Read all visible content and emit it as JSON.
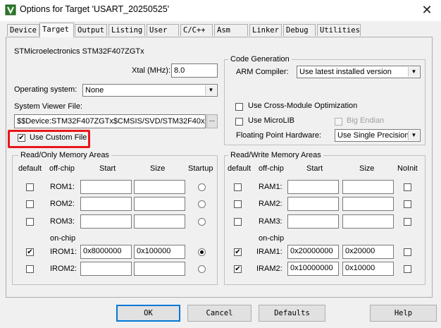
{
  "window": {
    "title": "Options for Target 'USART_20250525'",
    "close_glyph": "✕"
  },
  "tabs": [
    {
      "label": "Device"
    },
    {
      "label": "Target",
      "active": true
    },
    {
      "label": "Output"
    },
    {
      "label": "Listing"
    },
    {
      "label": "User"
    },
    {
      "label": "C/C++"
    },
    {
      "label": "Asm"
    },
    {
      "label": "Linker"
    },
    {
      "label": "Debug"
    },
    {
      "label": "Utilities"
    }
  ],
  "device_name": "STMicroelectronics STM32F407ZGTx",
  "xtal": {
    "label": "Xtal (MHz):",
    "value": "8.0"
  },
  "os": {
    "label": "Operating system:",
    "value": "None"
  },
  "svd": {
    "label": "System Viewer File:",
    "value": "$$Device:STM32F407ZGTx$CMSIS/SVD/STM32F40x",
    "browse": "..."
  },
  "custom_file": {
    "label": "Use Custom File",
    "checked": true
  },
  "code_gen": {
    "title": "Code Generation",
    "compiler_label": "ARM Compiler:",
    "compiler_value": "Use latest installed version",
    "cross_module": "Use Cross-Module Optimization",
    "microlib": "Use MicroLIB",
    "big_endian": "Big Endian",
    "fp_label": "Floating Point Hardware:",
    "fp_value": "Use Single Precision"
  },
  "rom": {
    "title": "Read/Only Memory Areas",
    "headers": {
      "default": "default",
      "offchip": "off-chip",
      "start": "Start",
      "size": "Size",
      "startup": "Startup"
    },
    "onchip_label": "on-chip",
    "rows": [
      {
        "name": "ROM1:",
        "start": "",
        "size": "",
        "default": false,
        "selected": false
      },
      {
        "name": "ROM2:",
        "start": "",
        "size": "",
        "default": false,
        "selected": false
      },
      {
        "name": "ROM3:",
        "start": "",
        "size": "",
        "default": false,
        "selected": false
      },
      {
        "name": "IROM1:",
        "start": "0x8000000",
        "size": "0x100000",
        "default": true,
        "selected": true
      },
      {
        "name": "IROM2:",
        "start": "",
        "size": "",
        "default": false,
        "selected": false
      }
    ]
  },
  "ram": {
    "title": "Read/Write Memory Areas",
    "headers": {
      "default": "default",
      "offchip": "off-chip",
      "start": "Start",
      "size": "Size",
      "noinit": "NoInit"
    },
    "onchip_label": "on-chip",
    "rows": [
      {
        "name": "RAM1:",
        "start": "",
        "size": "",
        "default": false,
        "noinit": false
      },
      {
        "name": "RAM2:",
        "start": "",
        "size": "",
        "default": false,
        "noinit": false
      },
      {
        "name": "RAM3:",
        "start": "",
        "size": "",
        "default": false,
        "noinit": false
      },
      {
        "name": "IRAM1:",
        "start": "0x20000000",
        "size": "0x20000",
        "default": true,
        "noinit": false
      },
      {
        "name": "IRAM2:",
        "start": "0x10000000",
        "size": "0x10000",
        "default": true,
        "noinit": false
      }
    ]
  },
  "buttons": {
    "ok": "OK",
    "cancel": "Cancel",
    "defaults": "Defaults",
    "help": "Help"
  },
  "check_glyph": "✔",
  "colors": {
    "highlight": "#e8161b",
    "default_button_border": "#0078d7"
  }
}
